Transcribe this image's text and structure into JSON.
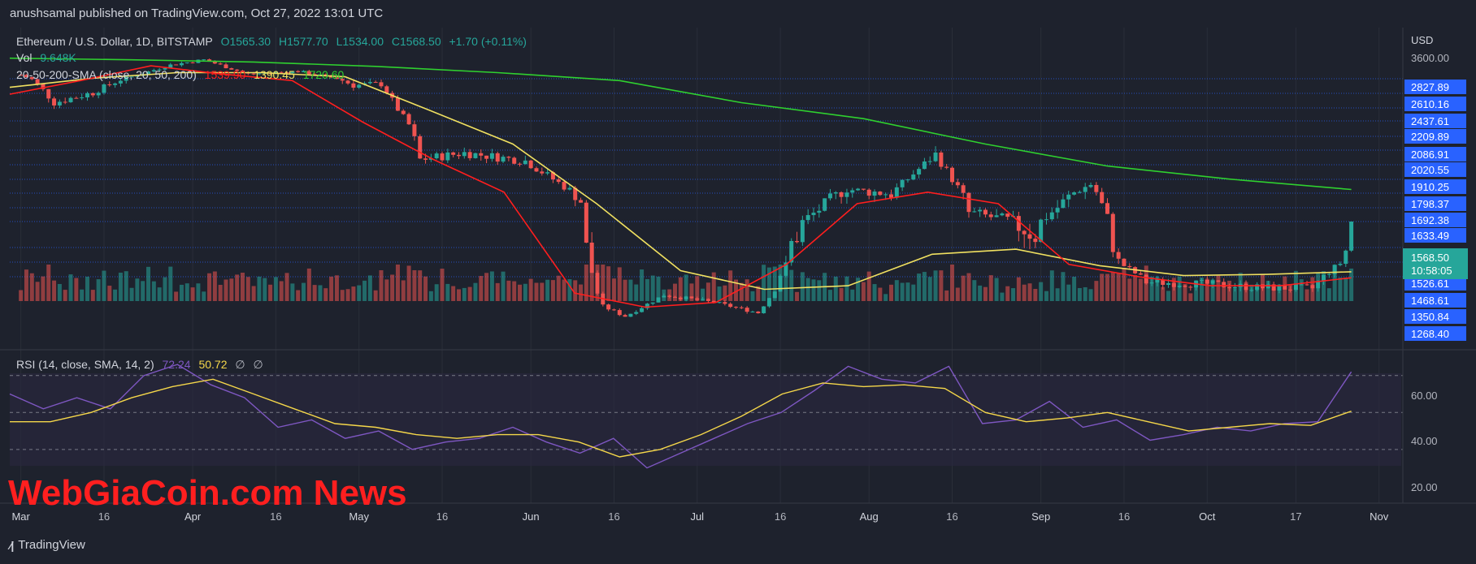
{
  "header": {
    "publisher": "anushsamal published on TradingView.com, Oct 27, 2022 13:01 UTC"
  },
  "legend": {
    "symbol": "Ethereum / U.S. Dollar, 1D, BITSTAMP",
    "open": "O1565.30",
    "high": "H1577.70",
    "low": "L1534.00",
    "close": "C1568.50",
    "change": "+1.70 (+0.11%)",
    "vol_label": "Vol",
    "vol_value": "9.648K",
    "sma_label": "20-50-200-SMA (close, 20, 50, 200)",
    "sma20": "1539.90",
    "sma50": "1390.45",
    "sma200": "1720.60",
    "rsi_label": "RSI (14, close, SMA, 14, 2)",
    "rsi_value": "72.24",
    "rsi_sma": "50.72",
    "rsi_extra1": "∅",
    "rsi_extra2": "∅"
  },
  "price_axis": {
    "currency": "USD",
    "top_label": "3600.00",
    "ticks": [
      "2827.89",
      "2610.16",
      "2437.61",
      "2209.89",
      "2086.91",
      "2020.55",
      "1910.25",
      "1798.37",
      "1692.38",
      "1633.49",
      "1526.61",
      "1468.61",
      "1350.84",
      "1268.40"
    ],
    "current_price": "1568.50",
    "countdown": "10:58:05"
  },
  "rsi_axis": {
    "ticks": [
      "60.00",
      "40.00",
      "20.00"
    ]
  },
  "time_axis": {
    "labels": [
      "Mar",
      "16",
      "Apr",
      "16",
      "May",
      "16",
      "Jun",
      "16",
      "Jul",
      "16",
      "Aug",
      "16",
      "Sep",
      "16",
      "Oct",
      "17",
      "Nov"
    ]
  },
  "watermark": "WebGiaCoin.com News",
  "footer": {
    "brand": "TradingView"
  },
  "colors": {
    "bg": "#1e222d",
    "up": "#26a69a",
    "down": "#ef5350",
    "sma20": "#ff1e1e",
    "sma50": "#f0e060",
    "sma200": "#2fd02f",
    "rsi": "#7e57c2",
    "rsi_sma": "#f5d74a",
    "hline": "#2962ff"
  },
  "chart_data": {
    "type": "candlestick",
    "title": "Ethereum / U.S. Dollar, 1D, BITSTAMP",
    "xlabel": "",
    "ylabel": "USD",
    "dates": [
      "2022-03-01 to 2022-10-27 daily"
    ],
    "x_ticks": [
      "Mar",
      "16",
      "Apr",
      "16",
      "May",
      "16",
      "Jun",
      "16",
      "Jul",
      "16",
      "Aug",
      "16",
      "Sep",
      "16",
      "Oct",
      "17",
      "Nov"
    ],
    "close_anchors": [
      {
        "date": "2022-03-01",
        "close": 2970
      },
      {
        "date": "2022-03-07",
        "close": 2500
      },
      {
        "date": "2022-03-14",
        "close": 2620
      },
      {
        "date": "2022-03-21",
        "close": 2900
      },
      {
        "date": "2022-03-28",
        "close": 3330
      },
      {
        "date": "2022-04-03",
        "close": 3520
      },
      {
        "date": "2022-04-11",
        "close": 3000
      },
      {
        "date": "2022-04-20",
        "close": 3100
      },
      {
        "date": "2022-04-30",
        "close": 2730
      },
      {
        "date": "2022-05-05",
        "close": 2750
      },
      {
        "date": "2022-05-12",
        "close": 1950
      },
      {
        "date": "2022-05-20",
        "close": 2000
      },
      {
        "date": "2022-05-31",
        "close": 1940
      },
      {
        "date": "2022-06-10",
        "close": 1660
      },
      {
        "date": "2022-06-14",
        "close": 1110
      },
      {
        "date": "2022-06-18",
        "close": 1000
      },
      {
        "date": "2022-06-25",
        "close": 1230
      },
      {
        "date": "2022-07-04",
        "close": 1150
      },
      {
        "date": "2022-07-12",
        "close": 1040
      },
      {
        "date": "2022-07-18",
        "close": 1530
      },
      {
        "date": "2022-07-28",
        "close": 1720
      },
      {
        "date": "2022-08-05",
        "close": 1690
      },
      {
        "date": "2022-08-13",
        "close": 1990
      },
      {
        "date": "2022-08-19",
        "close": 1610
      },
      {
        "date": "2022-08-31",
        "close": 1550
      },
      {
        "date": "2022-09-10",
        "close": 1760
      },
      {
        "date": "2022-09-15",
        "close": 1470
      },
      {
        "date": "2022-09-20",
        "close": 1320
      },
      {
        "date": "2022-10-01",
        "close": 1310
      },
      {
        "date": "2022-10-10",
        "close": 1290
      },
      {
        "date": "2022-10-20",
        "close": 1285
      },
      {
        "date": "2022-10-25",
        "close": 1460
      },
      {
        "date": "2022-10-27",
        "close": 1568.5
      }
    ],
    "sma20": [
      2600,
      2800,
      3300,
      3000,
      2800,
      2200,
      1950,
      1700,
      1250,
      1100,
      1150,
      1450,
      1650,
      1700,
      1650,
      1450,
      1350,
      1300,
      1300,
      1345
    ],
    "sma50": [
      2700,
      2850,
      3050,
      3050,
      2900,
      2400,
      2050,
      1650,
      1400,
      1280,
      1300,
      1500,
      1520,
      1440,
      1360,
      1370,
      1390.45
    ],
    "sma200": [
      3580,
      3520,
      3440,
      3280,
      3050,
      2800,
      2500,
      2250,
      2050,
      1900,
      1800,
      1720.6
    ],
    "price_axis_labels": [
      3600,
      2827.89,
      2610.16,
      2437.61,
      2209.89,
      2086.91,
      2020.55,
      1910.25,
      1798.37,
      1692.38,
      1633.49,
      1568.5,
      1526.61,
      1468.61,
      1350.84,
      1268.4
    ],
    "rsi": {
      "rsi_anchors": [
        60,
        52,
        58,
        52,
        70,
        76,
        65,
        58,
        42,
        46,
        36,
        40,
        30,
        34,
        36,
        42,
        34,
        28,
        36,
        20,
        28,
        36,
        44,
        50,
        62,
        75,
        68,
        66,
        75,
        44,
        46,
        56,
        42,
        46,
        35,
        38,
        42,
        40,
        44,
        45,
        72
      ],
      "rsi_sma_anchors": [
        45,
        45,
        50,
        58,
        64,
        68,
        60,
        52,
        44,
        42,
        38,
        36,
        38,
        38,
        34,
        26,
        30,
        38,
        48,
        60,
        66,
        64,
        65,
        63,
        50,
        45,
        47,
        50,
        45,
        40,
        42,
        44,
        43,
        50.72
      ],
      "ylim": [
        15,
        80
      ],
      "levels": [
        70,
        50,
        30
      ]
    }
  }
}
